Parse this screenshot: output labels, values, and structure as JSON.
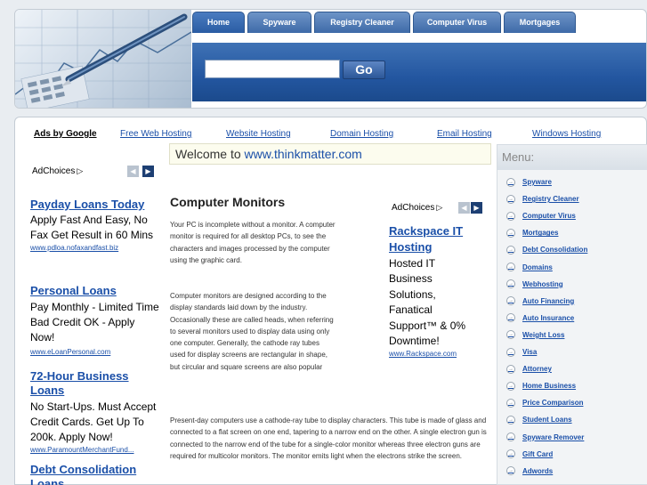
{
  "nav": {
    "tabs": [
      "Home",
      "Spyware",
      "Registry Cleaner",
      "Computer Virus",
      "Mortgages"
    ],
    "search_button": "Go"
  },
  "top_links": {
    "ads_by_google": "Ads by Google",
    "links": [
      "Free Web Hosting",
      "Website Hosting",
      "Domain Hosting",
      "Email Hosting",
      "Windows Hosting"
    ]
  },
  "welcome": {
    "prefix": "Welcome to ",
    "site": "www.thinkmatter.com"
  },
  "left_ads": {
    "adchoices": "AdChoices",
    "ads": [
      {
        "title": "Payday Loans Today",
        "body": "Apply Fast And Easy, No Fax Get Result in 60 Mins",
        "url": "www.pdloa.nofaxandfast.biz"
      },
      {
        "title": "Personal Loans",
        "body": "Pay Monthly - Limited Time Bad Credit OK - Apply Now!",
        "url": "www.eLoanPersonal.com"
      },
      {
        "title": "72-Hour Business Loans",
        "body": "No Start-Ups. Must Accept Credit Cards. Get Up To 200k. Apply Now!",
        "url": "www.ParamountMerchantFund..."
      },
      {
        "title": "Debt Consolidation Loans"
      }
    ]
  },
  "article": {
    "title": "Computer Monitors",
    "paragraphs": [
      "Your PC is incomplete without a monitor. A computer monitor is required for all desktop PCs, to see the characters and images processed by the computer using the graphic card.",
      "Computer monitors are designed according to the display standards laid down by the industry. Occasionally these are called heads, when referring to several monitors used to display data using only one computer. Generally, the cathode ray tubes used for display screens are rectangular in shape, but circular and square screens are also popular",
      "Present-day computers use a cathode-ray tube to display characters. This tube is made of glass and connected to a flat screen on one end, tapering to a narrow end on the other. A single electron gun is connected to the narrow end of the tube for a single-color monitor whereas three electron guns are required for multicolor monitors. The monitor emits light when the electrons strike the screen."
    ]
  },
  "inline_ad": {
    "adchoices": "AdChoices",
    "title": "Rackspace IT Hosting",
    "body": "Hosted IT Business Solutions, Fanatical Support™ & 0% Downtime!",
    "url": "www.Rackspace.com"
  },
  "menu": {
    "header": "Menu:",
    "items": [
      "Spyware",
      "Registry Cleaner",
      "Computer Virus",
      "Mortgages",
      "Debt Consolidation",
      "Domains",
      "Webhosting",
      "Auto Financing",
      "Auto Insurance",
      "Weight Loss",
      "Visa",
      "Attorney",
      "Home Business",
      "Price Comparison",
      "Student Loans",
      "Spyware Remover",
      "Gift Card",
      "Adwords"
    ]
  },
  "colors": {
    "link": "#1a4fa8",
    "nav_band": "#2356a0",
    "page_bg": "#e9edf1"
  }
}
